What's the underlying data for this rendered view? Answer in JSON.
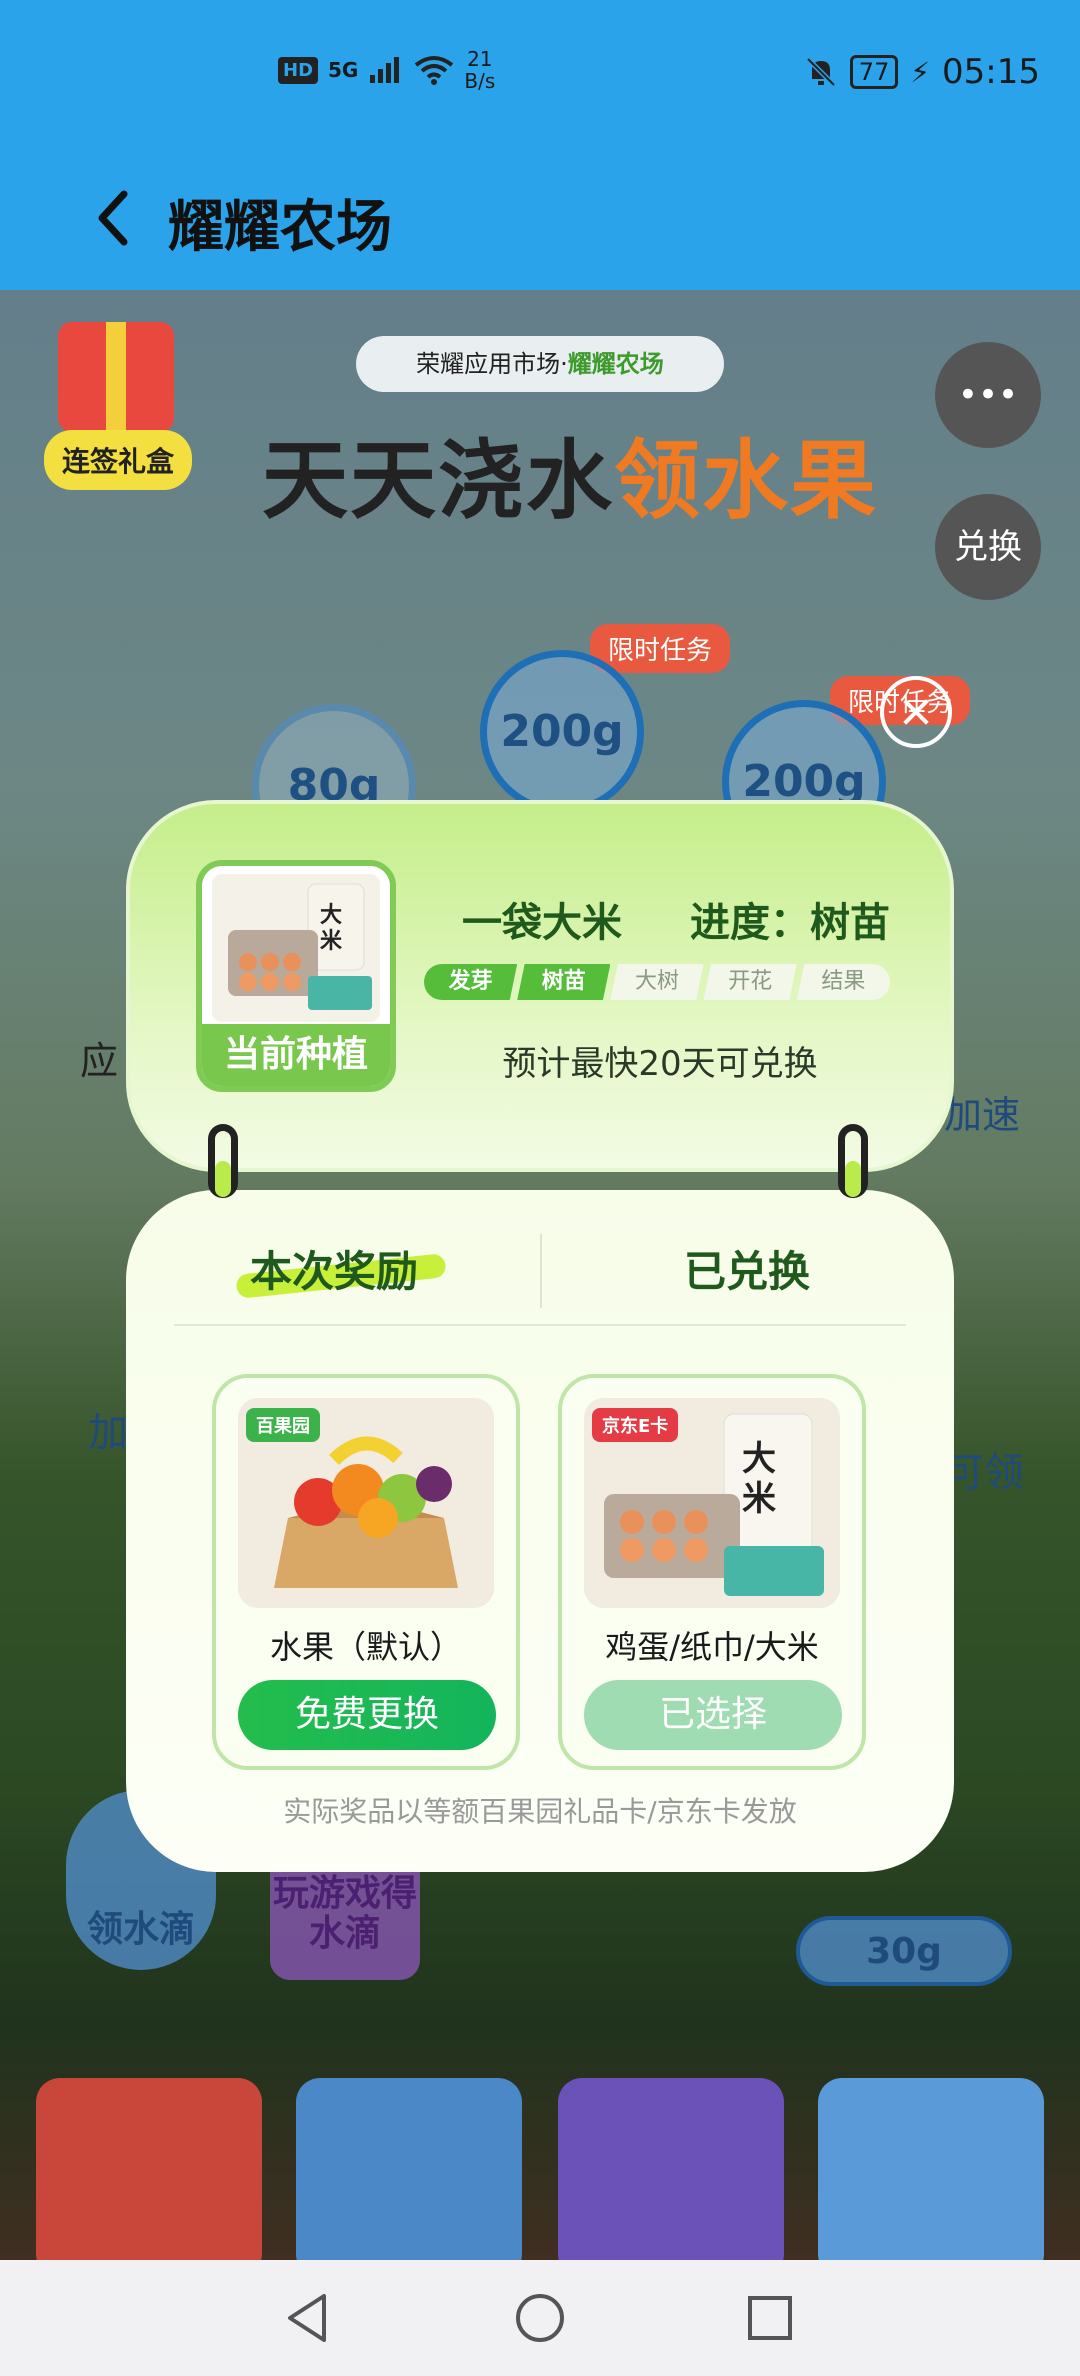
{
  "status_bar": {
    "hd": "HD",
    "network": "5G",
    "speed_value": "21",
    "speed_unit": "B/s",
    "battery": "77",
    "time": "05:15"
  },
  "app_bar": {
    "title": "耀耀农场"
  },
  "background": {
    "gift_label": "连签礼盒",
    "banner_prefix": "荣耀应用市场·",
    "banner_brand": "耀耀农场",
    "title_main": "天天浇水",
    "title_accent": "领水果",
    "more_button": "•••",
    "exchange_button": "兑换",
    "bubble_1": "200g",
    "bubble_2": "200g",
    "bubble_3": "80g",
    "limited_tag_1": "限时任务",
    "limited_tag_2": "限时任务",
    "left_stub_1": "应",
    "left_stub_2": "加",
    "right_stub_1": "加速",
    "right_stub_2": "可领",
    "bottom_1": "领水滴",
    "bottom_2": "玩游戏得水滴",
    "bottom_3": "30g"
  },
  "current_plant": {
    "label": "当前种植",
    "crop_name": "一袋大米",
    "progress_label": "进度：树苗",
    "stages": [
      {
        "name": "发芽",
        "done": true
      },
      {
        "name": "树苗",
        "done": true
      },
      {
        "name": "大树",
        "done": false
      },
      {
        "name": "开花",
        "done": false
      },
      {
        "name": "结果",
        "done": false
      }
    ],
    "estimate": "预计最快20天可兑换"
  },
  "reward_panel": {
    "tab_reward": "本次奖励",
    "tab_exchanged": "已兑换",
    "prizes": [
      {
        "badge": "百果园",
        "name": "水果（默认）",
        "button": "免费更换"
      },
      {
        "badge": "京东E卡",
        "name": "鸡蛋/纸巾/大米",
        "button": "已选择"
      }
    ],
    "footnote": "实际奖品以等额百果园礼品卡/京东卡发放"
  },
  "colors": {
    "app_bar": "#2ba3ea",
    "primary_green": "#24bd4c",
    "dark_green_text": "#1f5a1c"
  }
}
